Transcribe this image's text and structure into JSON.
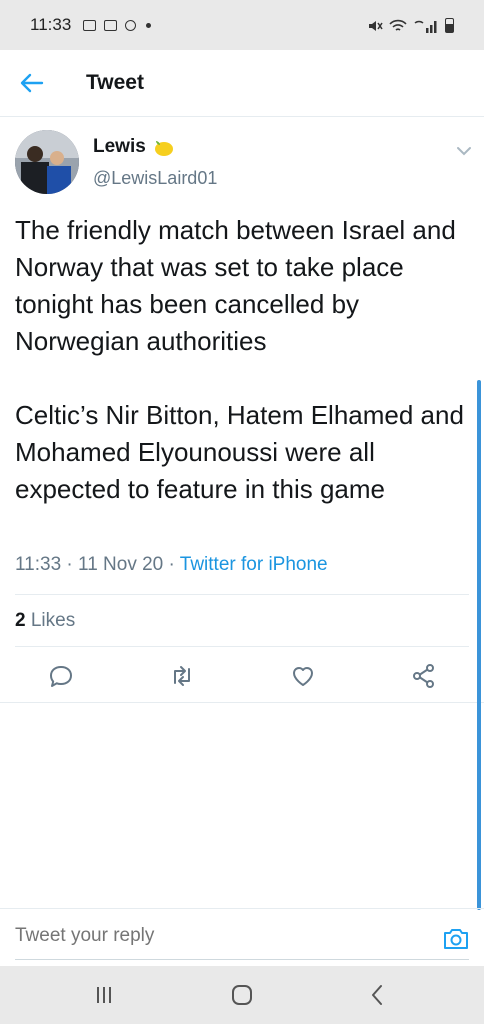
{
  "status_bar": {
    "time": "11:33"
  },
  "header": {
    "title": "Tweet"
  },
  "tweet": {
    "author_name": "Lewis",
    "author_handle": "@LewisLaird01",
    "text_paragraphs": [
      "The friendly match between Israel and Norway that was set to take place tonight has been cancelled by Norwegian authorities",
      "Celtic’s Nir Bitton, Hatem Elhamed and Mohamed Elyounoussi were all expected to feature in this game"
    ],
    "time": "11:33",
    "date": "11 Nov 20",
    "source": "Twitter for iPhone",
    "likes_count": "2",
    "likes_label": "Likes"
  },
  "reply": {
    "placeholder": "Tweet your reply"
  },
  "colors": {
    "accent": "#1da1f2",
    "secondary_text": "#657786",
    "primary_text": "#14171a",
    "divider": "#e6ecf0"
  },
  "icons": [
    "back-arrow-icon",
    "lemon-emoji-icon",
    "chevron-down-icon",
    "reply-icon",
    "retweet-icon",
    "like-icon",
    "share-icon",
    "camera-icon",
    "recent-apps-icon",
    "home-icon",
    "back-icon"
  ]
}
